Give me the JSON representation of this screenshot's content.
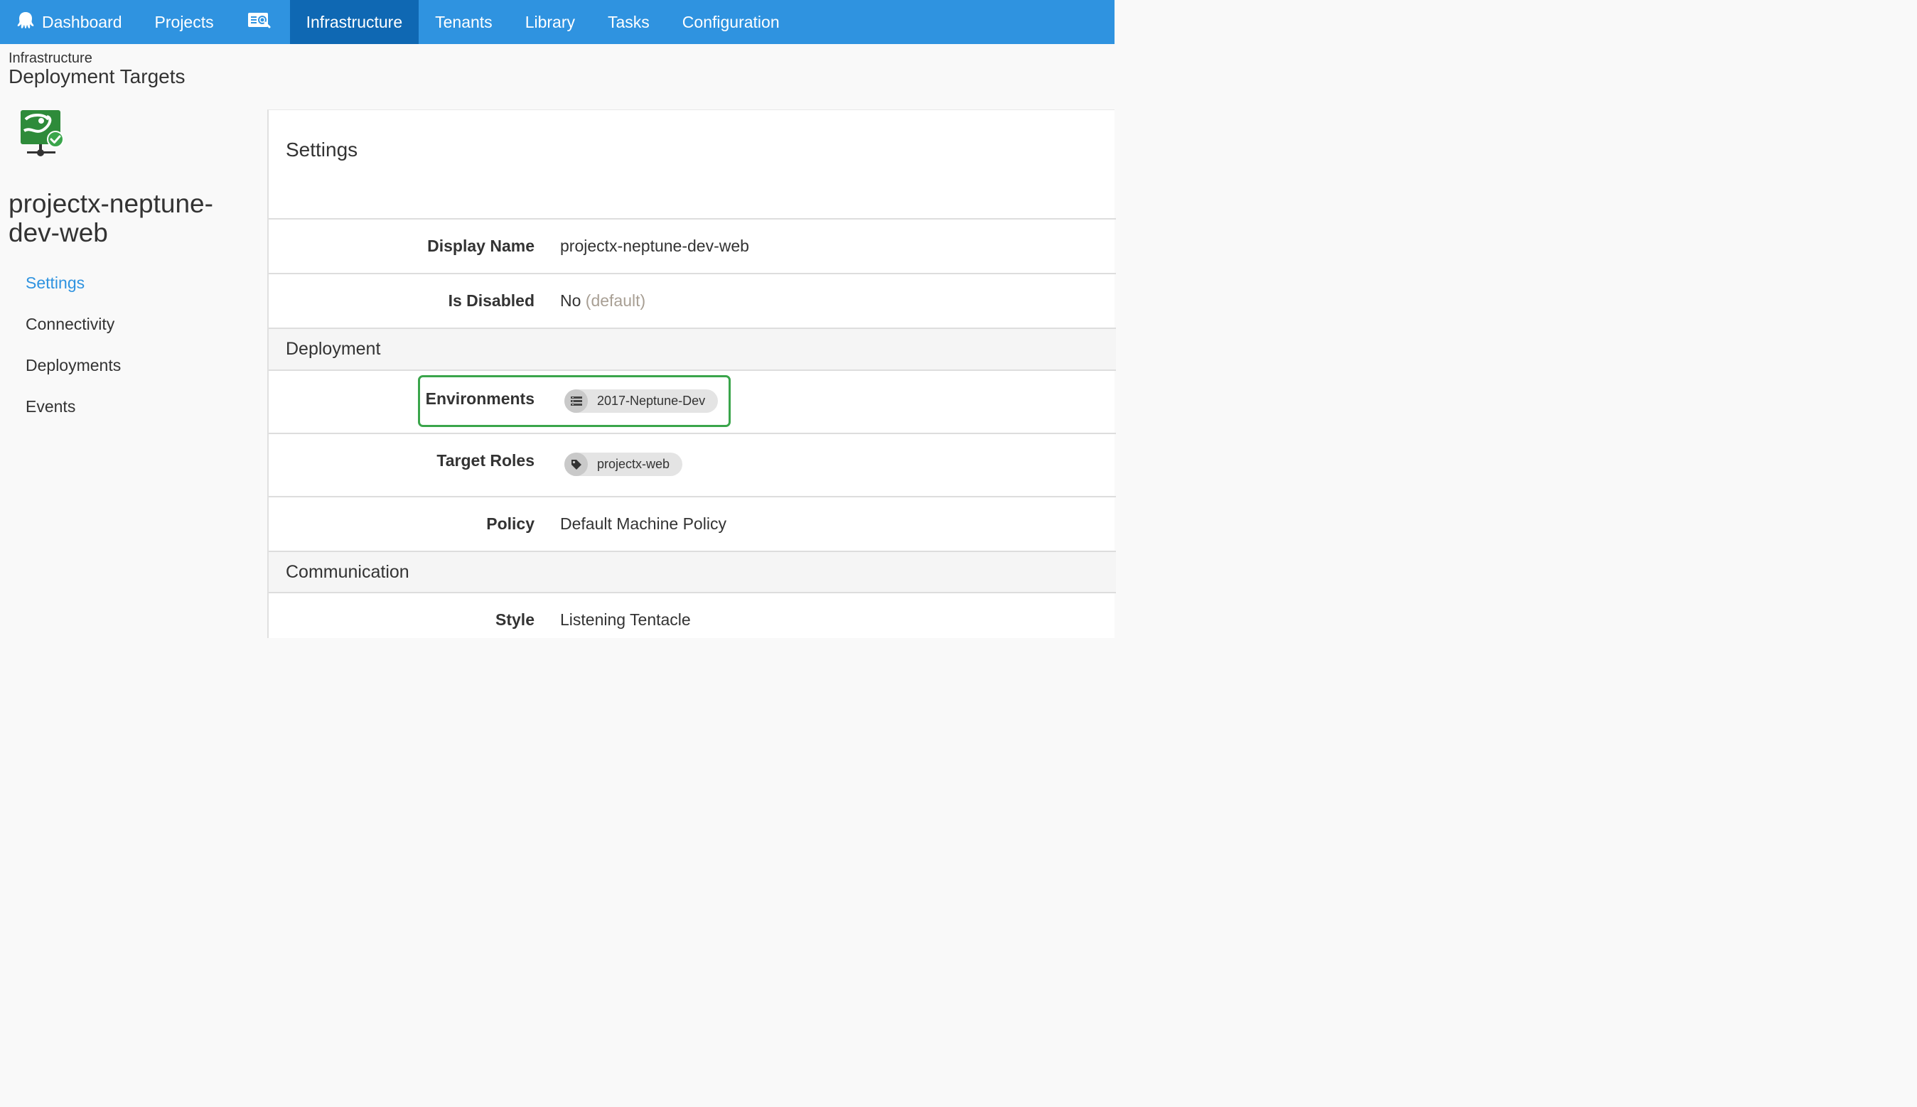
{
  "nav": {
    "items": [
      {
        "label": "Dashboard"
      },
      {
        "label": "Projects"
      },
      {
        "label": "Infrastructure"
      },
      {
        "label": "Tenants"
      },
      {
        "label": "Library"
      },
      {
        "label": "Tasks"
      },
      {
        "label": "Configuration"
      }
    ],
    "active": "Infrastructure"
  },
  "breadcrumb": "Infrastructure",
  "page_title": "Deployment Targets",
  "machine": {
    "name": "projectx-neptune-dev-web",
    "status_icon": "check-circle-icon"
  },
  "side_nav": [
    {
      "label": "Settings",
      "active": true
    },
    {
      "label": "Connectivity"
    },
    {
      "label": "Deployments"
    },
    {
      "label": "Events"
    }
  ],
  "settings": {
    "title": "Settings",
    "display_name": {
      "label": "Display Name",
      "value": "projectx-neptune-dev-web"
    },
    "is_disabled": {
      "label": "Is Disabled",
      "value": "No",
      "note": "(default)"
    },
    "deployment_section": "Deployment",
    "environments": {
      "label": "Environments",
      "chip": "2017-Neptune-Dev"
    },
    "target_roles": {
      "label": "Target Roles",
      "chip": "projectx-web"
    },
    "policy": {
      "label": "Policy",
      "value": "Default Machine Policy"
    },
    "communication_section": "Communication",
    "style": {
      "label": "Style",
      "value": "Listening Tentacle"
    }
  },
  "colors": {
    "nav_bg": "#2f93e0",
    "nav_active": "#0f68b3",
    "accent": "#2f93e0",
    "highlight": "#3aa54b",
    "brand_green": "#2e8b3a"
  }
}
